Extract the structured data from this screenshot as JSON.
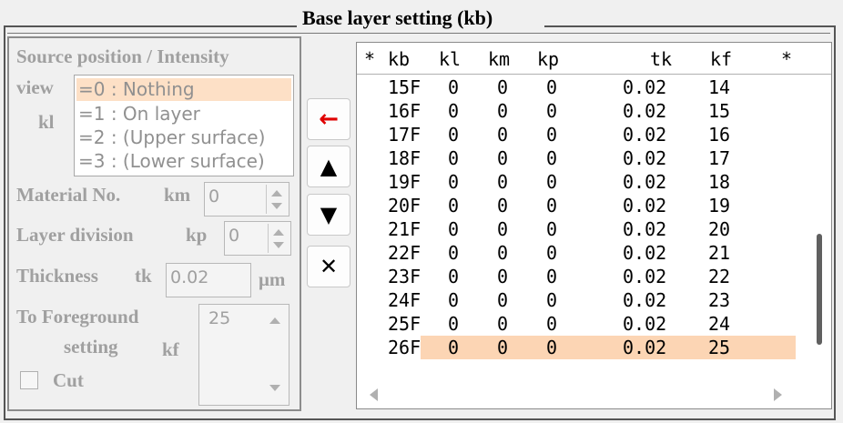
{
  "title": "Base layer setting (kb)",
  "left_panel": {
    "source_label": "Source position / Intensity",
    "view_label": "view",
    "kl_label": "kl",
    "kl_options": [
      "=0 : Nothing",
      "=1 : On layer",
      "=2 : (Upper surface)",
      "=3 : (Lower surface)"
    ],
    "kl_selected": "=0 : Nothing",
    "material_label": "Material No.",
    "km_label": "km",
    "km_value": "0",
    "layer_division_label": "Layer division",
    "kp_label": "kp",
    "kp_value": "0",
    "thickness_label": "Thickness",
    "tk_label": "tk",
    "tk_value": "0.02",
    "unit": "μm",
    "foreground_label_1": "To Foreground",
    "foreground_label_2": "setting",
    "kf_label": "kf",
    "kf_value": "25",
    "cut_label": "Cut"
  },
  "buttons": {
    "insert_icon": "←",
    "up_icon": "▲",
    "down_icon": "▼",
    "delete_icon": "✕"
  },
  "table": {
    "columns": [
      "*",
      "kb",
      "kl",
      "km",
      "kp",
      "tk",
      "kf",
      "*"
    ],
    "rows": [
      [
        "15F",
        "0",
        "0",
        "0",
        "0.02",
        "14"
      ],
      [
        "16F",
        "0",
        "0",
        "0",
        "0.02",
        "15"
      ],
      [
        "17F",
        "0",
        "0",
        "0",
        "0.02",
        "16"
      ],
      [
        "18F",
        "0",
        "0",
        "0",
        "0.02",
        "17"
      ],
      [
        "19F",
        "0",
        "0",
        "0",
        "0.02",
        "18"
      ],
      [
        "20F",
        "0",
        "0",
        "0",
        "0.02",
        "19"
      ],
      [
        "21F",
        "0",
        "0",
        "0",
        "0.02",
        "20"
      ],
      [
        "22F",
        "0",
        "0",
        "0",
        "0.02",
        "21"
      ],
      [
        "23F",
        "0",
        "0",
        "0",
        "0.02",
        "22"
      ],
      [
        "24F",
        "0",
        "0",
        "0",
        "0.02",
        "23"
      ],
      [
        "25F",
        "0",
        "0",
        "0",
        "0.02",
        "24"
      ],
      [
        "26F",
        "0",
        "0",
        "0",
        "0.02",
        "25"
      ]
    ],
    "selected_row": 11
  },
  "colors": {
    "selection": "#fcd5b4",
    "listbox_selection": "#fde0c6",
    "disabled_text": "#a0a0a0",
    "insert_arrow": "#e00000"
  }
}
